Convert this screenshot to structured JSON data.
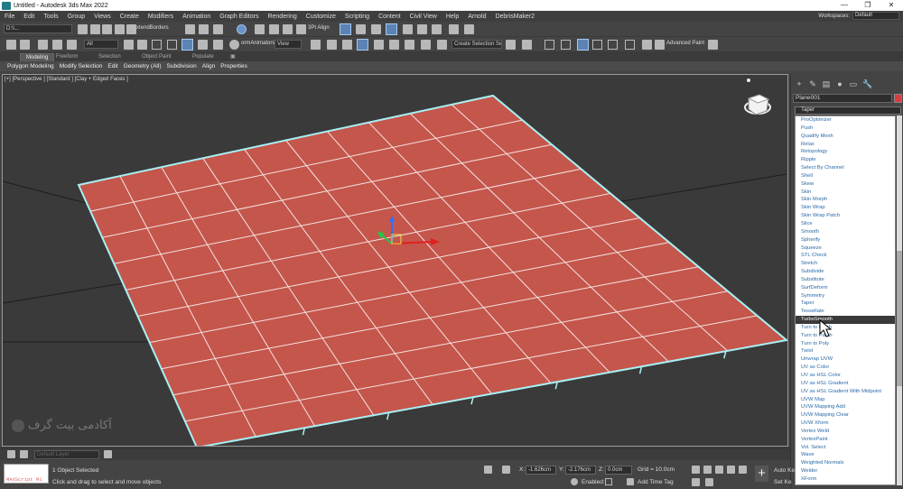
{
  "titlebar": {
    "title": "Untitled - Autodesk 3ds Max 2022",
    "min": "—",
    "max": "❐",
    "close": "✕"
  },
  "menu": [
    "File",
    "Edit",
    "Tools",
    "Group",
    "Views",
    "Create",
    "Modifiers",
    "Animation",
    "Graph Editors",
    "Rendering",
    "Customize",
    "Scripting",
    "Content",
    "Civil View",
    "Help",
    "Arnold",
    "DebrisMaker2"
  ],
  "workspace": {
    "label": "Workspaces:",
    "value": "Default"
  },
  "toolbar1": {
    "undo_dropdown": "D:\\\\...",
    "extended_borders": "xtendBorders",
    "pt_align": "3Pt Align"
  },
  "toolbar2": {
    "filter": "All",
    "animators": "ormAnimators",
    "view": "View",
    "selection_set": "Create Selection Se",
    "advanced_paint": "Advanced Paint"
  },
  "ribbon": {
    "tabs": [
      "Modeling",
      "Freeform",
      "Selection",
      "Object Paint",
      "Populate"
    ],
    "sub": [
      "Polygon Modeling",
      "Modify Selection",
      "Edit",
      "Geometry (All)",
      "Subdivision",
      "Align",
      "Properties"
    ]
  },
  "viewport": {
    "label": "[+] [Perspective ] [Standard ] [Clay + Edged Faces ]",
    "plane_color": "#c5564c",
    "edge_color": "#a8f0f4"
  },
  "watermark": "آکادمی بیت گرف",
  "command_panel": {
    "tabs": [
      "+",
      "✎",
      "▤",
      "●",
      "▭",
      "🔧"
    ],
    "object_name": "Plane001",
    "object_color": "#d93d3d",
    "modifier_dropdown": "Taper",
    "modifiers": [
      "ProOptimizer",
      "Push",
      "Quadify Mesh",
      "Relax",
      "Retopology",
      "Ripple",
      "Select By Channel",
      "Shell",
      "Skew",
      "Skin",
      "Skin Morph",
      "Skin Wrap",
      "Skin Wrap Patch",
      "Slice",
      "Smooth",
      "Spherify",
      "Squeeze",
      "STL Check",
      "Stretch",
      "Subdivide",
      "Substitute",
      "SurfDeform",
      "Symmetry",
      "Taper",
      "Tessellate",
      "TurboSmooth",
      "Turn to Mesh",
      "Turn to Patch",
      "Turn to Poly",
      "Twist",
      "Unwrap UVW",
      "UV as Color",
      "UV as HSL Color",
      "UV as HSL Gradient",
      "UV as HSL Gradient With Midpoint",
      "UVW Map",
      "UVW Mapping Add",
      "UVW Mapping Clear",
      "UVW Xform",
      "Vertex Weld",
      "VertexPaint",
      "Vol. Select",
      "Wave",
      "Weighted Normals",
      "Welder",
      "XForm"
    ],
    "selected_modifier": "TurboSmooth"
  },
  "status": {
    "script_label": "MAXScript Mi",
    "selection": "1 Object Selected",
    "prompt": "Click and drag to select and move objects",
    "x_label": "X:",
    "x_value": "-1.626cm",
    "y_label": "Y:",
    "y_value": "-2.176cm",
    "z_label": "Z:",
    "z_value": "0.0cm",
    "grid": "Grid = 10.0cm",
    "enabled": "Enabled:",
    "add_time_tag": "Add Time Tag",
    "auto_key": "Auto Ke",
    "set_key": "Set Ke"
  },
  "timebar": {
    "layer_field": "Default Layer"
  }
}
